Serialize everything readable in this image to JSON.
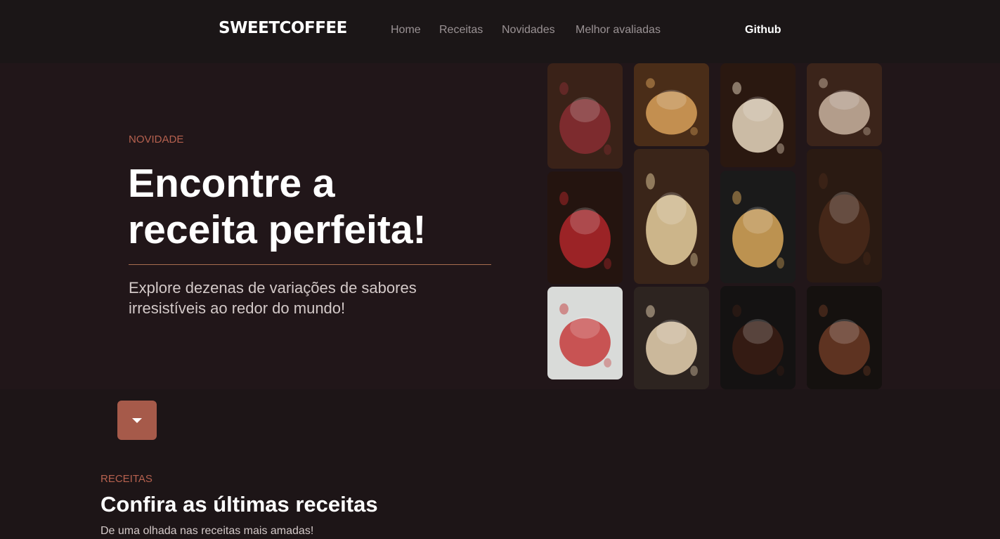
{
  "brand": {
    "name": "SWEETCOFFEE"
  },
  "nav": {
    "links": [
      "Home",
      "Receitas",
      "Novidades",
      "Melhor avaliadas"
    ],
    "github": "Github"
  },
  "hero": {
    "eyebrow": "NOVIDADE",
    "title_line1": "Encontre a",
    "title_line2": "receita perfeita!",
    "subtitle_line1": "Explore dezenas de variações de sabores",
    "subtitle_line2": "irresistíveis ao redor do mundo!"
  },
  "gallery": {
    "tiles": [
      {
        "subject": "chocolate dessert with berries",
        "base": "#3a2218",
        "accent": "#8a2d33"
      },
      {
        "subject": "caramel latte with cat foam",
        "base": "#4a2d18",
        "accent": "#d8a15a"
      },
      {
        "subject": "iced coffee with whipped cream",
        "base": "#2a1810",
        "accent": "#e8d8c0"
      },
      {
        "subject": "hot chocolate with marshmallows",
        "base": "#3b241a",
        "accent": "#c9b3a0"
      },
      {
        "subject": "chocolate layer cake with strawberries",
        "base": "#24140f",
        "accent": "#b0262a"
      },
      {
        "subject": "chocolate chip pie with ice cream",
        "base": "#3a2519",
        "accent": "#e6cf9f"
      },
      {
        "subject": "banana pancakes",
        "base": "#1a1a1a",
        "accent": "#d9a85a"
      },
      {
        "subject": "brownie stack",
        "base": "#2a1a12",
        "accent": "#4a2a1a"
      },
      {
        "subject": "strawberry pancakes",
        "base": "#d9dbd9",
        "accent": "#c43b3b"
      },
      {
        "subject": "chocolate macarons",
        "base": "#2d2420",
        "accent": "#e7d2b2"
      },
      {
        "subject": "chocolate drip cake",
        "base": "#141212",
        "accent": "#3a1d14"
      },
      {
        "subject": "hot cocoa in glass mug",
        "base": "#15110f",
        "accent": "#6b3a24"
      }
    ]
  },
  "scroll_button": {
    "icon": "chevron-down-icon"
  },
  "recipes_section": {
    "eyebrow": "RECEITAS",
    "title": "Confira as últimas receitas",
    "subtitle": "De uma olhada nas receitas mais amadas!"
  },
  "colors": {
    "background": "#1d1517",
    "hero_bg": "#211619",
    "accent": "#a65a4a",
    "eyebrow": "#b6614f"
  }
}
